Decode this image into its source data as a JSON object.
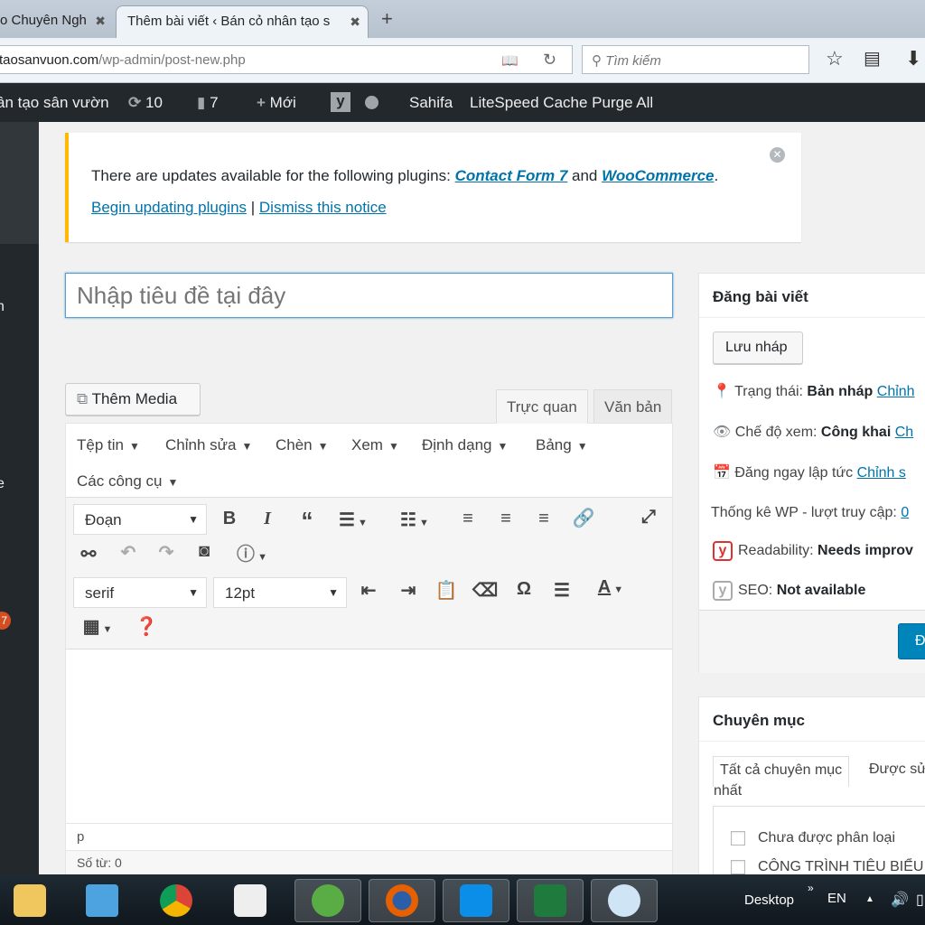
{
  "browser": {
    "tabs": [
      {
        "label": "o Chuyên Ngh",
        "active": false
      },
      {
        "label": "Thêm bài viết ‹ Bán cỏ nhân tạo s",
        "active": true
      }
    ],
    "url_host": "taosanvuon.com",
    "url_path": "/wp-admin/post-new.php",
    "search_placeholder": "Tìm kiếm"
  },
  "adminbar": {
    "site": "ân tạo sân vườn",
    "updates": "10",
    "comments": "7",
    "new": "Mới",
    "items": [
      "Sahifa",
      "LiteSpeed Cache Purge All"
    ]
  },
  "sidebar": {
    "labels": [
      "n",
      "e"
    ],
    "badge": "7"
  },
  "notice": {
    "text": "There are updates available for the following plugins: ",
    "plugin1": "Contact Form 7",
    "and": " and ",
    "plugin2": "WooCommerce",
    "period": ".",
    "begin": "Begin updating plugins",
    "sep": " | ",
    "dismiss": "Dismiss this notice"
  },
  "title_placeholder": "Nhập tiêu đề tại đây",
  "editor": {
    "add_media": "Thêm Media",
    "tabs": [
      "Trực quan",
      "Văn bản"
    ],
    "menu": [
      "Tệp tin",
      "Chỉnh sửa",
      "Chèn",
      "Xem",
      "Định dạng",
      "Bảng",
      "Các công cụ"
    ],
    "format": "Đoạn",
    "font": "serif",
    "size": "12pt",
    "path": "p",
    "word_count": "Số từ: 0"
  },
  "publish": {
    "title": "Đăng bài viết",
    "save_draft": "Lưu nháp",
    "status_label": "Trạng thái: ",
    "status": "Bản nháp",
    "edit": "Chỉnh",
    "visibility_label": "Chế độ xem: ",
    "visibility": "Công khai",
    "visibility_edit": "Ch",
    "schedule": "Đăng ngay lập tức",
    "schedule_edit": "Chỉnh s",
    "stats_label": "Thống kê WP - lượt truy cập: ",
    "stats": "0",
    "readability_label": "Readability: ",
    "readability": "Needs improv",
    "seo_label": "SEO: ",
    "seo": "Not available",
    "publish_button": "Đ"
  },
  "categories": {
    "title": "Chuyên mục",
    "tab_all": "Tất cả chuyên mục",
    "tab_popular": "Được sử",
    "tab_popular_2": "nhất",
    "items": [
      "Chưa được phân loại",
      "CÔNG TRÌNH TIÊU BIỂU"
    ]
  },
  "taskbar": {
    "desktop": "Desktop",
    "lang": "EN",
    "apps": [
      "file-explorer",
      "media-player",
      "chrome",
      "unikey",
      "coc-coc",
      "firefox",
      "zalo",
      "excel",
      "paint"
    ]
  },
  "colors": {
    "accent": "#0073aa",
    "notice": "#ffb900",
    "adminbar": "#23282d",
    "publish": "#0085ba",
    "readability": "#dc3232"
  }
}
